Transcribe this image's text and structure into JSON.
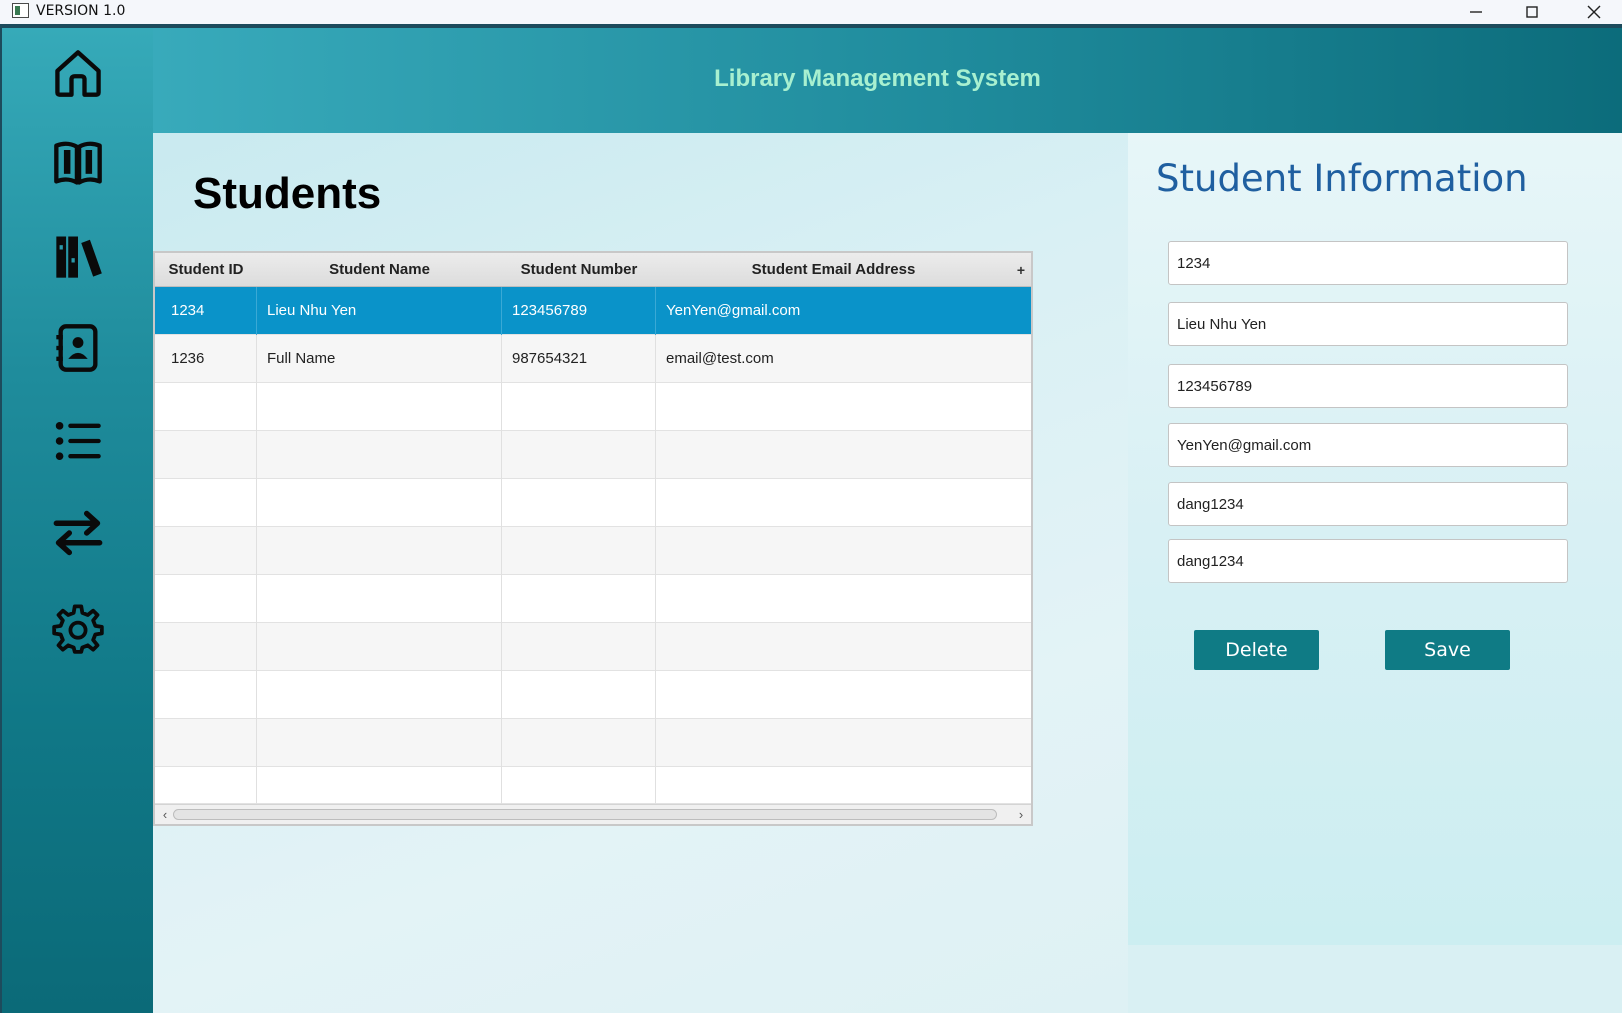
{
  "window": {
    "title": "VERSION 1.0"
  },
  "header": {
    "app_title": "Library Management System"
  },
  "sidebar": {
    "items": [
      {
        "icon": "home-icon"
      },
      {
        "icon": "book-icon"
      },
      {
        "icon": "library-icon"
      },
      {
        "icon": "contact-book-icon"
      },
      {
        "icon": "list-icon"
      },
      {
        "icon": "transfer-icon"
      },
      {
        "icon": "gear-icon"
      }
    ]
  },
  "main": {
    "page_title": "Students",
    "table": {
      "columns": [
        "Student ID",
        "Student Name",
        "Student Number",
        "Student Email Address"
      ],
      "column_menu": "+",
      "rows": [
        [
          "1234",
          "Lieu Nhu Yen",
          "123456789",
          "YenYen@gmail.com"
        ],
        [
          "1236",
          "Full Name",
          "987654321",
          "email@test.com"
        ]
      ],
      "selected_row": 0
    }
  },
  "info": {
    "title": "Student Information",
    "fields": [
      "1234",
      "Lieu Nhu Yen",
      "123456789",
      "YenYen@gmail.com",
      "dang1234",
      "dang1234"
    ],
    "delete_label": "Delete",
    "save_label": "Save"
  },
  "colors": {
    "accent": "#0f7b85",
    "selected_row": "#0a93c9",
    "title_text": "#a8f0d0",
    "info_title": "#1f5fa0"
  }
}
